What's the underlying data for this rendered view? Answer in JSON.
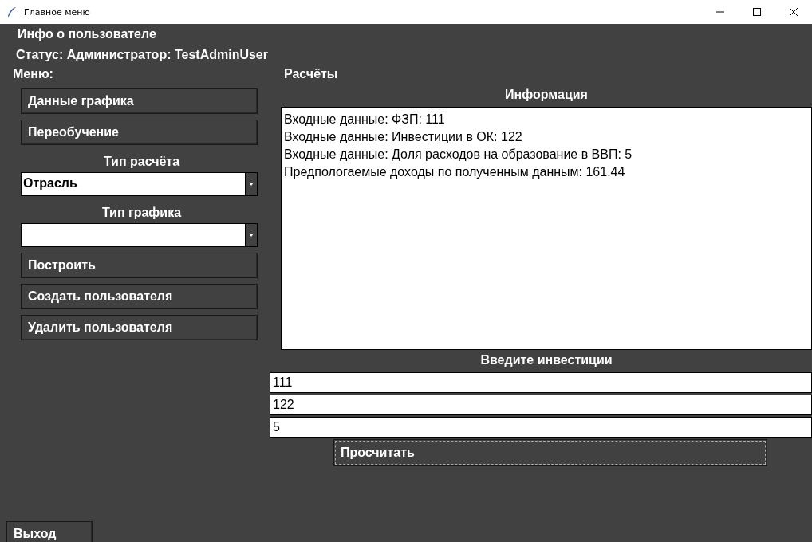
{
  "window": {
    "title": "Главное меню"
  },
  "user_info": {
    "title": "Инфо о пользователе",
    "status": "Статус: Администратор: TestAdminUser"
  },
  "menu": {
    "label": "Меню:",
    "items": [
      {
        "kind": "button",
        "text": "Данные графика"
      },
      {
        "kind": "button",
        "text": "Переобучение"
      },
      {
        "kind": "label",
        "text": "Тип расчёта"
      },
      {
        "kind": "dropdown",
        "value": "Отрасль"
      },
      {
        "kind": "label",
        "text": "Тип графика"
      },
      {
        "kind": "dropdown"
      },
      {
        "kind": "button",
        "text": "Построить"
      },
      {
        "kind": "button",
        "text": "Создать пользователя"
      },
      {
        "kind": "button",
        "text": "Удалить пользователя"
      }
    ]
  },
  "calculations": {
    "title": "Расчёты",
    "info_title": "Информация",
    "info_lines": [
      "Входные данные: ФЗП: 111",
      "Входные данные: Инвестиции в ОК: 122",
      "Входные данные: Доля расходов на образование в ВВП: 5",
      "Предпологаемые доходы по полученным данным: 161.44"
    ],
    "input_title": "Введите инвестиции",
    "inputs": [
      "111",
      "122",
      "5"
    ],
    "calc_button": {
      "text": "Просчитать",
      "focused": true
    }
  },
  "exit_button": "Выход"
}
